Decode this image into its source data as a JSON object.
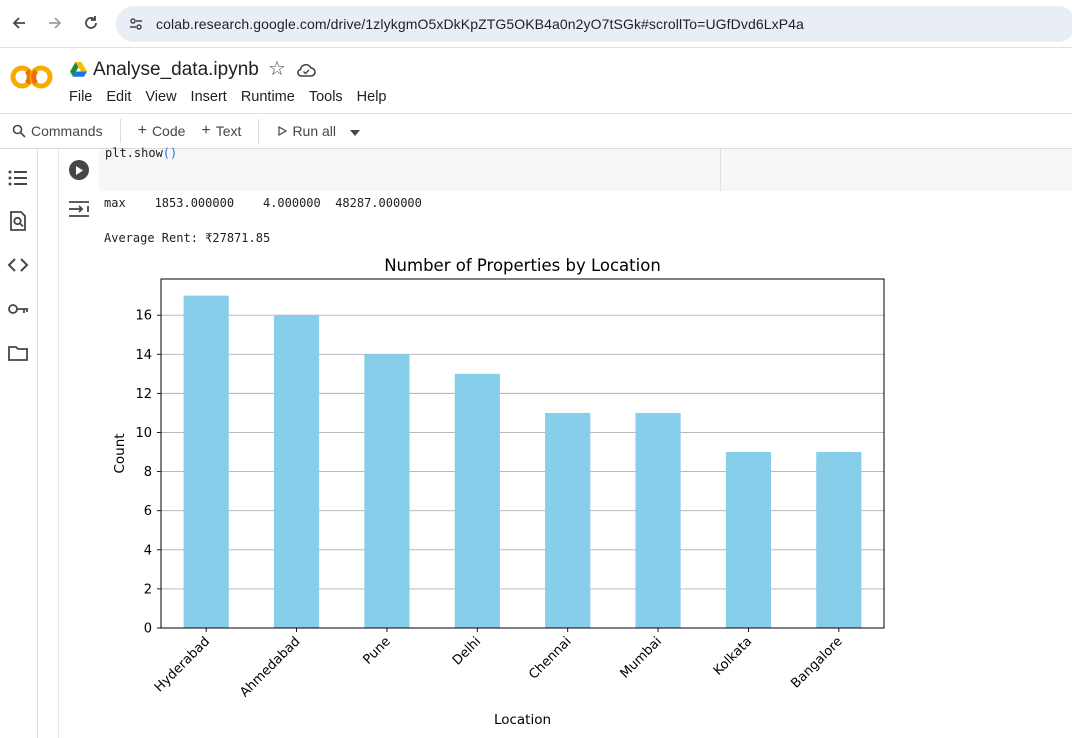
{
  "browser": {
    "url": "colab.research.google.com/drive/1zlykgmO5xDkKpZTG5OKB4a0n2yO7tSGk#scrollTo=UGfDvd6LxP4a"
  },
  "header": {
    "file_name": "Analyse_data.ipynb",
    "menu": [
      "File",
      "Edit",
      "View",
      "Insert",
      "Runtime",
      "Tools",
      "Help"
    ]
  },
  "toolbar": {
    "commands_label": "Commands",
    "code_label": "Code",
    "text_label": "Text",
    "run_all_label": "Run all"
  },
  "cell": {
    "code_text": "plt.show",
    "code_parens": "()",
    "output_stats_line": "max    1853.000000    4.000000  48287.000000",
    "output_avg_line": "Average Rent: ₹27871.85"
  },
  "colors": {
    "bar": "#87ceeb",
    "grid": "#b0b0b0",
    "accent": "#1a73e8"
  },
  "chart_data": {
    "type": "bar",
    "title": "Number of Properties by Location",
    "xlabel": "Location",
    "ylabel": "Count",
    "categories": [
      "Hyderabad",
      "Ahmedabad",
      "Pune",
      "Delhi",
      "Chennai",
      "Mumbai",
      "Kolkata",
      "Bangalore"
    ],
    "values": [
      17,
      16,
      14,
      13,
      11,
      11,
      9,
      9
    ],
    "ylim": [
      0,
      17.85
    ],
    "yticks": [
      "0",
      "2",
      "4",
      "6",
      "8",
      "10",
      "12",
      "14",
      "16"
    ],
    "grid": "y-axis",
    "legend": "none"
  }
}
